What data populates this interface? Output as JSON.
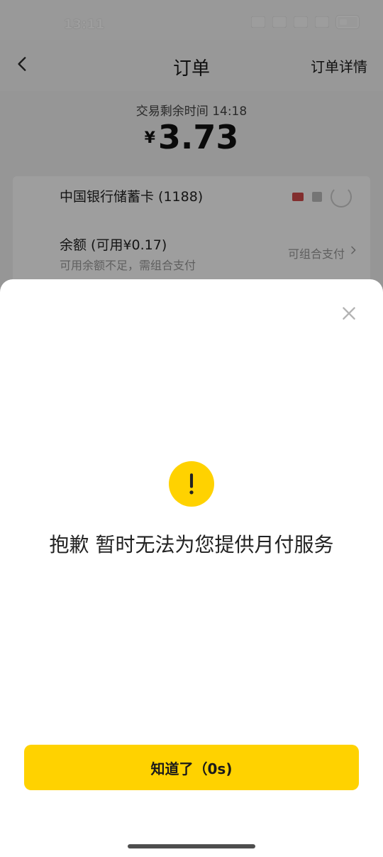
{
  "status": {
    "time": "13:11"
  },
  "header": {
    "title": "订单",
    "detail_label": "订单详情"
  },
  "order": {
    "timer_text": "交易剩余时间 14:18",
    "currency_symbol": "¥",
    "amount": "3.73"
  },
  "payment": {
    "bank_label": "中国银行储蓄卡 (1188)",
    "balance_label": "余额 (可用¥0.17)",
    "balance_hint": "可用余额不足，需组合支付",
    "combine_label": "可组合支付"
  },
  "dialog": {
    "message": "抱歉 暂时无法为您提供月付服务",
    "confirm_label": "知道了（0s)"
  },
  "colors": {
    "accent": "#ffd200",
    "overlay": "rgba(0,0,0,0.38)"
  },
  "icons": [
    "back-icon",
    "close-icon",
    "warning-icon",
    "chevron-right-icon"
  ]
}
